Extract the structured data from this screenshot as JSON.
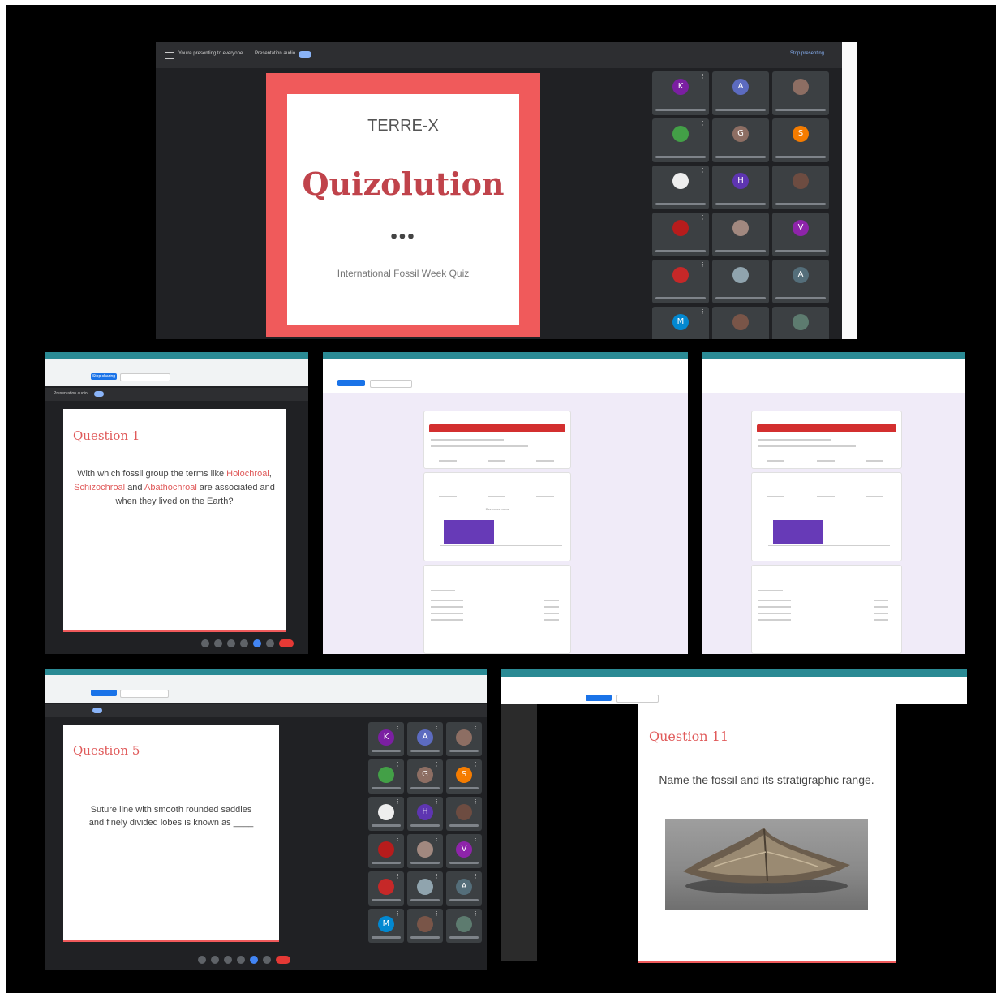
{
  "main": {
    "top_bar_title": "You're presenting to everyone",
    "presentation_toggle_label": "Presentation audio",
    "stop_label": "Stop presenting",
    "slide": {
      "org": "TERRE-X",
      "title": "Quizolution",
      "dots": "•••",
      "subtitle": "International Fossil Week Quiz"
    },
    "participants": [
      {
        "initial": "K",
        "color": "#7b1fa2"
      },
      {
        "initial": "A",
        "color": "#5c6bc0"
      },
      {
        "initial": "",
        "color": "#8d6e63"
      },
      {
        "initial": "",
        "color": "#43a047"
      },
      {
        "initial": "G",
        "color": "#8d6e63"
      },
      {
        "initial": "S",
        "color": "#f57c00"
      },
      {
        "initial": "",
        "color": "#eeeeee"
      },
      {
        "initial": "H",
        "color": "#5e35b1"
      },
      {
        "initial": "",
        "color": "#6d4c41"
      },
      {
        "initial": "",
        "color": "#b71c1c"
      },
      {
        "initial": "",
        "color": "#a1887f"
      },
      {
        "initial": "V",
        "color": "#8e24aa"
      },
      {
        "initial": "",
        "color": "#c62828"
      },
      {
        "initial": "",
        "color": "#90a4ae"
      },
      {
        "initial": "A",
        "color": "#546e7a"
      },
      {
        "initial": "M",
        "color": "#0288d1"
      },
      {
        "initial": "",
        "color": "#795548"
      },
      {
        "initial": "",
        "color": "#5d7b6f"
      }
    ]
  },
  "q1": {
    "title": "Question 1",
    "text_before": "With which fossil group the terms like",
    "term1": "Holochroal",
    "term2": "Schizochroal",
    "text_and": "and",
    "term3": "Abathochroal",
    "text_after": "are associated and when they lived on the Earth?",
    "present_button": "Stop sharing",
    "toggle_label": "Presentation audio"
  },
  "q5": {
    "title": "Question 5",
    "text": "Suture line with smooth rounded saddles and finely divided lobes is known as ____"
  },
  "q11": {
    "title": "Question 11",
    "text": "Name the fossil and its stratigraphic range."
  },
  "forms": {
    "chart_label": "Response value"
  },
  "colors": {
    "accent": "#e05a5a",
    "teal": "#2a8a94",
    "purple": "#673ab7",
    "meet_dark": "#202124"
  }
}
